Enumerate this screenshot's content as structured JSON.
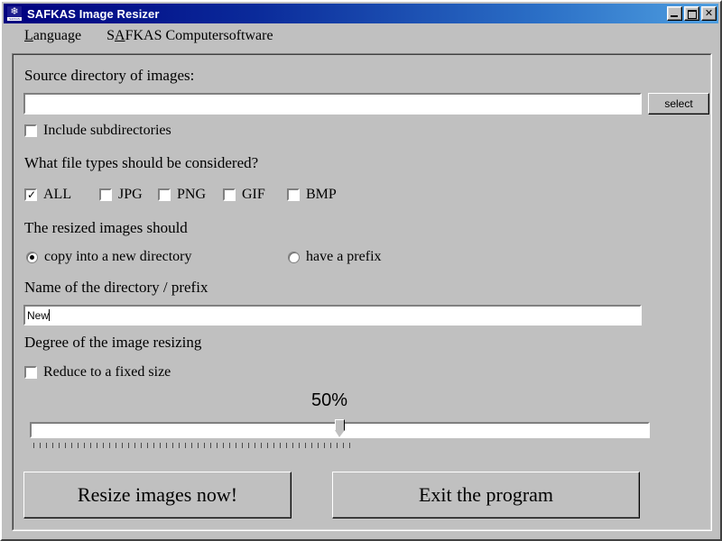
{
  "window": {
    "title": "SAFKAS Image Resizer",
    "icon": "snowflake-logo-icon",
    "controls": {
      "minimize": "minimize-button",
      "maximize": "maximize-button",
      "close_label": "✕"
    }
  },
  "menubar": {
    "items": [
      {
        "prefix": "",
        "mnemonic": "L",
        "suffix": "anguage"
      },
      {
        "prefix": "S",
        "mnemonic": "A",
        "suffix": "FKAS Computersoftware"
      }
    ]
  },
  "form": {
    "source_label": "Source directory of images:",
    "source_value": "",
    "source_placeholder": "",
    "select_button": "select",
    "include_subdirs": {
      "label": "Include subdirectories",
      "checked": false
    },
    "filetypes_question": "What file types should be considered?",
    "filetypes": [
      {
        "label": "ALL",
        "checked": true
      },
      {
        "label": "JPG",
        "checked": false
      },
      {
        "label": "PNG",
        "checked": false
      },
      {
        "label": "GIF",
        "checked": false
      },
      {
        "label": "BMP",
        "checked": false
      }
    ],
    "resized_should_label": "The resized images should",
    "resize_mode": [
      {
        "label": "copy into a new directory",
        "selected": true
      },
      {
        "label": "have a prefix",
        "selected": false
      }
    ],
    "name_label": "Name of the directory / prefix",
    "name_value": "New",
    "degree_label": "Degree of the image resizing",
    "fixed_size": {
      "label": "Reduce to a fixed size",
      "checked": false
    },
    "slider": {
      "value_text": "50%",
      "value": 50,
      "min": 0,
      "max": 100,
      "tick_count": 51
    }
  },
  "actions": {
    "resize_button": "Resize images now!",
    "exit_button": "Exit the program"
  },
  "colors": {
    "face": "#c0c0c0",
    "title_start": "#00007f",
    "title_end": "#4f9fe0",
    "text": "#000000",
    "field_bg": "#ffffff"
  }
}
